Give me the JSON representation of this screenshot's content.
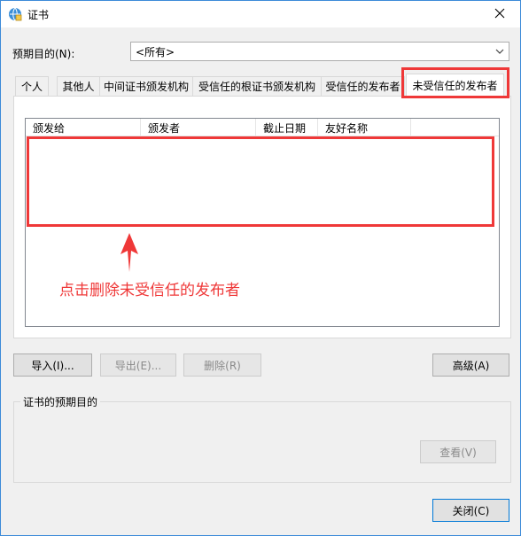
{
  "window": {
    "title": "证书",
    "icon": "certificate-globe-icon",
    "close_icon": "close-icon"
  },
  "purpose": {
    "label": "预期目的(N):",
    "selected": "<所有>"
  },
  "tabs": [
    {
      "label": "个人"
    },
    {
      "label": "其他人"
    },
    {
      "label": "中间证书颁发机构"
    },
    {
      "label": "受信任的根证书颁发机构"
    },
    {
      "label": "受信任的发布者"
    },
    {
      "label": "未受信任的发布者",
      "active": true
    }
  ],
  "list": {
    "columns": [
      "颁发给",
      "颁发者",
      "截止日期",
      "友好名称"
    ],
    "rows": []
  },
  "annotation": {
    "text": "点击删除未受信任的发布者",
    "color": "#ef3838"
  },
  "buttons": {
    "import": "导入(I)...",
    "export": "导出(E)...",
    "remove": "删除(R)",
    "advanced": "高级(A)",
    "view": "查看(V)",
    "close": "关闭(C)"
  },
  "group": {
    "label": "证书的预期目的"
  },
  "colors": {
    "accent": "#0078d7",
    "highlight": "#ef3838",
    "window_bg": "#f0f0f0"
  }
}
